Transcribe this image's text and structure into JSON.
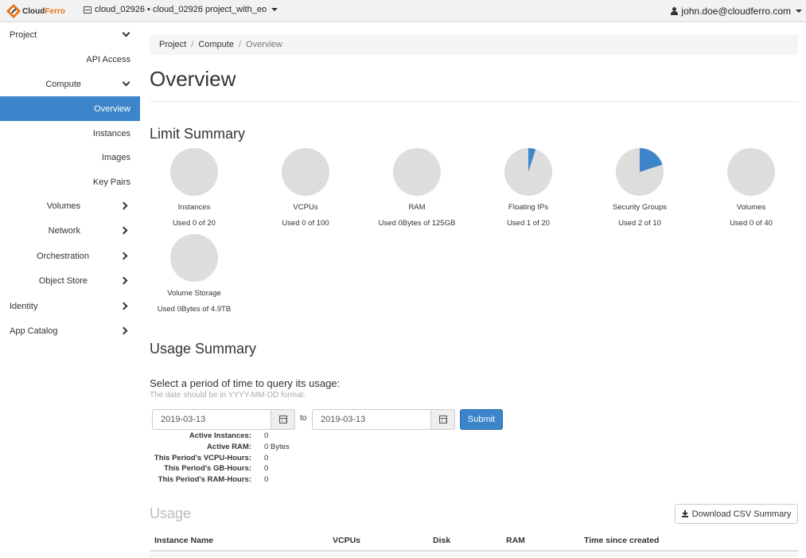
{
  "topbar": {
    "logo": {
      "cloud": "Cloud",
      "ferro": "Ferro"
    },
    "project": "cloud_02926 • cloud_02926 project_with_eo",
    "user": "john.doe@cloudferro.com"
  },
  "sidebar": {
    "project": "Project",
    "api_access": "API Access",
    "compute": "Compute",
    "overview": "Overview",
    "instances": "Instances",
    "images": "Images",
    "key_pairs": "Key Pairs",
    "volumes": "Volumes",
    "network": "Network",
    "orchestration": "Orchestration",
    "object_store": "Object Store",
    "identity": "Identity",
    "app_catalog": "App Catalog"
  },
  "breadcrumb": {
    "project": "Project",
    "compute": "Compute",
    "current": "Overview",
    "sep": "/"
  },
  "page_title": "Overview",
  "limit_summary": {
    "title": "Limit Summary",
    "colors": {
      "used": "#3c85cb",
      "free": "#dddddd"
    },
    "items": [
      {
        "label": "Instances",
        "used_text": "Used 0 of 20",
        "used": 0,
        "total": 20
      },
      {
        "label": "VCPUs",
        "used_text": "Used 0 of 100",
        "used": 0,
        "total": 100
      },
      {
        "label": "RAM",
        "used_text": "Used 0Bytes of 125GB",
        "used": 0,
        "total": 125
      },
      {
        "label": "Floating IPs",
        "used_text": "Used 1 of 20",
        "used": 1,
        "total": 20
      },
      {
        "label": "Security Groups",
        "used_text": "Used 2 of 10",
        "used": 2,
        "total": 10
      },
      {
        "label": "Volumes",
        "used_text": "Used 0 of 40",
        "used": 0,
        "total": 40
      },
      {
        "label": "Volume Storage",
        "used_text": "Used 0Bytes of 4.9TB",
        "used": 0,
        "total": 4.9
      }
    ]
  },
  "usage_summary": {
    "title": "Usage Summary",
    "query_title": "Select a period of time to query its usage:",
    "query_help": "The date should be in YYYY-MM-DD format.",
    "start_date": "2019-03-13",
    "end_date": "2019-03-13",
    "to": "to",
    "submit": "Submit",
    "stats": [
      {
        "label": "Active Instances:",
        "value": "0"
      },
      {
        "label": "Active RAM:",
        "value": "0 Bytes"
      },
      {
        "label": "This Period's VCPU-Hours:",
        "value": "0"
      },
      {
        "label": "This Period's GB-Hours:",
        "value": "0"
      },
      {
        "label": "This Period's RAM-Hours:",
        "value": "0"
      }
    ]
  },
  "usage": {
    "title": "Usage",
    "download": "Download CSV Summary",
    "columns": [
      "Instance Name",
      "VCPUs",
      "Disk",
      "RAM",
      "Time since created"
    ]
  }
}
